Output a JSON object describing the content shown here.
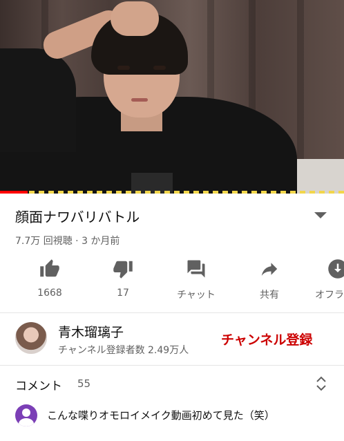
{
  "video": {
    "progress_fraction": 0.08,
    "progress_color": "#ff0000",
    "chapter_marker_color": "#f2d64b"
  },
  "info": {
    "title": "顔面ナワバリバトル",
    "meta": "7.7万 回視聴 · 3 か月前",
    "expand_icon": "chevron-down-icon"
  },
  "actions": [
    {
      "icon": "thumbs-up-icon",
      "label": "1668"
    },
    {
      "icon": "thumbs-down-icon",
      "label": "17"
    },
    {
      "icon": "chat-icon",
      "label": "チャット"
    },
    {
      "icon": "share-icon",
      "label": "共有"
    },
    {
      "icon": "download-icon",
      "label": "オフラ"
    }
  ],
  "channel": {
    "name": "青木瑠璃子",
    "subscribers": "チャンネル登録者数 2.49万人",
    "subscribe_label": "チャンネル登録",
    "subscribe_color": "#cc0000"
  },
  "comments": {
    "title": "コメント",
    "count": "55",
    "top_comment": "こんな喋りオモロイメイク動画初めて見た（笑）",
    "avatar_color": "#7b3fb6"
  }
}
